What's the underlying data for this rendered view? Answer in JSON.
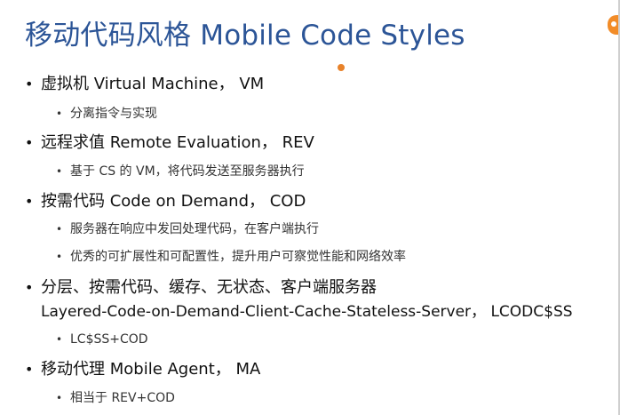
{
  "title": "移动代码风格 Mobile Code Styles",
  "bullet_glyph": "•",
  "items": [
    {
      "text": "虚拟机 Virtual Machine， VM",
      "sub": [
        "分离指令与实现"
      ]
    },
    {
      "text": "远程求值 Remote Evaluation， REV",
      "sub": [
        "基于 CS 的 VM，将代码发送至服务器执行"
      ]
    },
    {
      "text": "按需代码 Code on Demand， COD",
      "sub": [
        "服务器在响应中发回处理代码，在客户端执行",
        "优秀的可扩展性和可配置性，提升用户可察觉性能和网络效率"
      ]
    },
    {
      "text": "分层、按需代码、缓存、无状态、客户端服务器",
      "text_line2": "Layered-Code-on-Demand-Client-Cache-Stateless-Server， LCODC$SS",
      "sub": [
        "LC$SS+COD"
      ]
    },
    {
      "text": "移动代理 Mobile Agent， MA",
      "sub": [
        "相当于 REV+COD"
      ]
    }
  ],
  "colors": {
    "title": "#2c5597",
    "pointer": "#e8822a",
    "edge_tab": "#f28c28"
  }
}
